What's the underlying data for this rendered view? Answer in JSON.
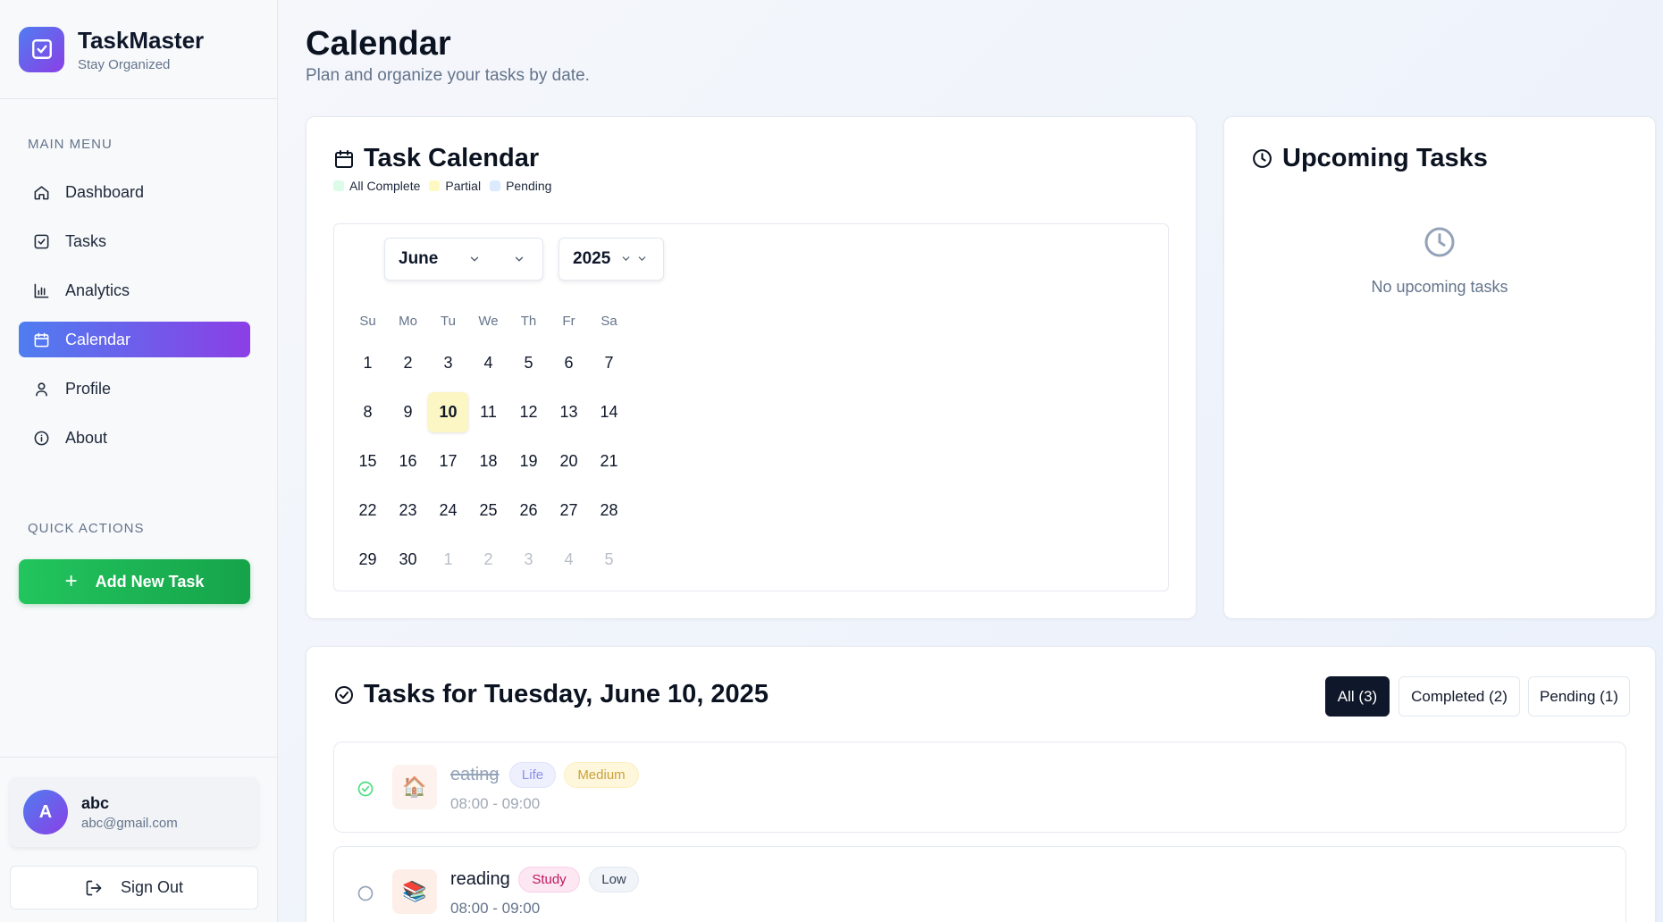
{
  "brand": {
    "name": "TaskMaster",
    "subtitle": "Stay Organized"
  },
  "sidebar": {
    "main_menu_label": "MAIN MENU",
    "items": [
      {
        "label": "Dashboard",
        "icon": "home-icon",
        "active": false
      },
      {
        "label": "Tasks",
        "icon": "checkbox-icon",
        "active": false
      },
      {
        "label": "Analytics",
        "icon": "bar-chart-icon",
        "active": false
      },
      {
        "label": "Calendar",
        "icon": "calendar-icon",
        "active": true
      },
      {
        "label": "Profile",
        "icon": "user-icon",
        "active": false
      },
      {
        "label": "About",
        "icon": "info-icon",
        "active": false
      }
    ],
    "quick_actions_label": "QUICK ACTIONS",
    "add_task_label": "Add New Task"
  },
  "user": {
    "initial": "A",
    "name": "abc",
    "email": "abc@gmail.com"
  },
  "signout_label": "Sign Out",
  "page": {
    "title": "Calendar",
    "subtitle": "Plan and organize your tasks by date."
  },
  "calendar_card": {
    "title": "Task Calendar",
    "legend": [
      {
        "label": "All Complete",
        "color": "#dcfce7"
      },
      {
        "label": "Partial",
        "color": "#fef9c3"
      },
      {
        "label": "Pending",
        "color": "#dbeafe"
      }
    ],
    "month": "June",
    "year": "2025",
    "weekdays": [
      "Su",
      "Mo",
      "Tu",
      "We",
      "Th",
      "Fr",
      "Sa"
    ],
    "weeks": [
      [
        "1",
        "2",
        "3",
        "4",
        "5",
        "6",
        "7"
      ],
      [
        "8",
        "9",
        "10",
        "11",
        "12",
        "13",
        "14"
      ],
      [
        "15",
        "16",
        "17",
        "18",
        "19",
        "20",
        "21"
      ],
      [
        "22",
        "23",
        "24",
        "25",
        "26",
        "27",
        "28"
      ],
      [
        "29",
        "30",
        "1",
        "2",
        "3",
        "4",
        "5"
      ]
    ],
    "selected_day": "10"
  },
  "upcoming": {
    "title": "Upcoming Tasks",
    "empty_text": "No upcoming tasks"
  },
  "tasks_section": {
    "title": "Tasks for Tuesday, June 10, 2025",
    "filters": {
      "all": "All (3)",
      "completed": "Completed (2)",
      "pending": "Pending (1)"
    },
    "tasks": [
      {
        "name": "eating",
        "category": "Life",
        "priority": "Medium",
        "time": "08:00 - 09:00",
        "completed": true,
        "emoji": "🏠"
      },
      {
        "name": "reading",
        "category": "Study",
        "priority": "Low",
        "time": "08:00 - 09:00",
        "completed": false,
        "emoji": "📚"
      }
    ]
  },
  "colors": {
    "accent_start": "#4f7df0",
    "accent_end": "#8b3fe6",
    "success": "#22c55e"
  }
}
